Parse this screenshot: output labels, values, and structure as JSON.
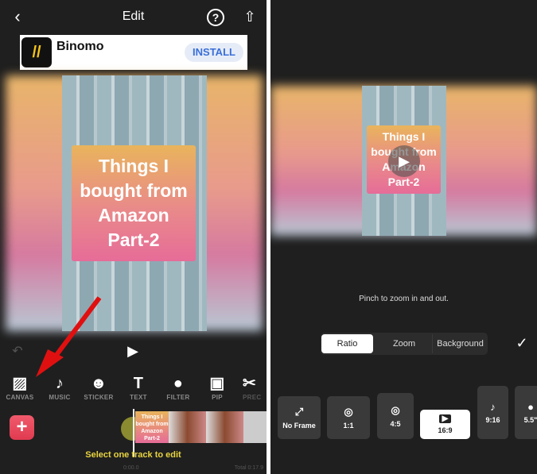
{
  "left": {
    "header": {
      "title": "Edit",
      "back_icon": "chevron-left-icon",
      "help_icon": "question-circle-icon",
      "share_icon": "share-icon"
    },
    "ad": {
      "name": "Binomo",
      "button": "INSTALL"
    },
    "preview": {
      "caption_lines": [
        "Things I",
        "bought from",
        "Amazon",
        "Part-2"
      ]
    },
    "tools": [
      {
        "label": "CANVAS",
        "icon": "canvas-icon"
      },
      {
        "label": "MUSIC",
        "icon": "music-icon"
      },
      {
        "label": "STICKER",
        "icon": "sticker-icon"
      },
      {
        "label": "TEXT",
        "icon": "text-icon"
      },
      {
        "label": "FILTER",
        "icon": "filter-icon"
      },
      {
        "label": "PIP",
        "icon": "pip-icon"
      },
      {
        "label": "PREC",
        "icon": "scissors-icon"
      }
    ],
    "timeline": {
      "thumb_caption": "Things I bought from Amazon Part-2",
      "hint": "Select one track to edit",
      "current_time": "0:00.0",
      "total": "Total 0:17.9"
    },
    "accent": "#e8485e"
  },
  "right": {
    "hint": "Pinch to zoom in and out.",
    "preview": {
      "caption_lines": [
        "Things I",
        "bought from",
        "Amazon",
        "Part-2"
      ]
    },
    "tabs": [
      {
        "label": "Ratio",
        "selected": true
      },
      {
        "label": "Zoom"
      },
      {
        "label": "Background"
      }
    ],
    "ratios": [
      {
        "label": "No Frame",
        "icon": "expand-icon"
      },
      {
        "label": "1:1",
        "icon": "instagram-icon"
      },
      {
        "label": "4:5",
        "icon": "instagram-icon"
      },
      {
        "label": "16:9",
        "icon": "youtube-icon",
        "selected": true
      },
      {
        "label": "9:16",
        "icon": "tiktok-icon"
      },
      {
        "label": "5.5\"",
        "icon": "apple-icon"
      }
    ]
  }
}
